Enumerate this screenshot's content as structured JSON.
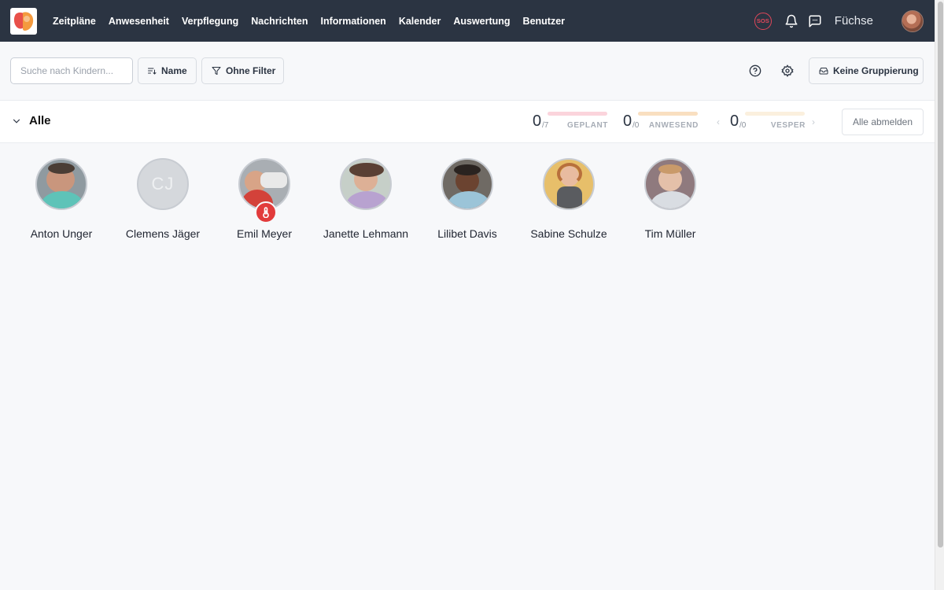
{
  "nav": {
    "items": [
      "Zeitpläne",
      "Anwesenheit",
      "Verpflegung",
      "Nachrichten",
      "Informationen",
      "Kalender",
      "Auswertung",
      "Benutzer"
    ],
    "sos_label": "SOS",
    "group_name": "Füchse"
  },
  "toolbar": {
    "search_placeholder": "Suche nach Kindern...",
    "sort_label": "Name",
    "filter_label": "Ohne Filter",
    "grouping_label": "Keine Gruppierung"
  },
  "group": {
    "title": "Alle",
    "stats": [
      {
        "value": "0",
        "total": "/7",
        "label": "GEPLANT",
        "color": "#fbd4dc"
      },
      {
        "value": "0",
        "total": "/0",
        "label": "ANWESEND",
        "color": "#f9dfc0"
      },
      {
        "value": "0",
        "total": "/0",
        "label": "VESPER",
        "color": "#fbf0de"
      }
    ],
    "logout_label": "Alle abmelden"
  },
  "children": [
    {
      "name": "Anton Unger",
      "photo": true
    },
    {
      "name": "Clemens Jäger",
      "initials": "CJ",
      "photo": false
    },
    {
      "name": "Emil Meyer",
      "photo": true,
      "badge": "thermometer-icon"
    },
    {
      "name": "Janette Lehmann",
      "photo": true
    },
    {
      "name": "Lilibet Davis",
      "photo": true
    },
    {
      "name": "Sabine Schulze",
      "photo": true
    },
    {
      "name": "Tim Müller",
      "photo": true
    }
  ],
  "colors": {
    "topbar": "#2b3442",
    "alert": "#e23b3b",
    "background": "#f7f8fa"
  }
}
